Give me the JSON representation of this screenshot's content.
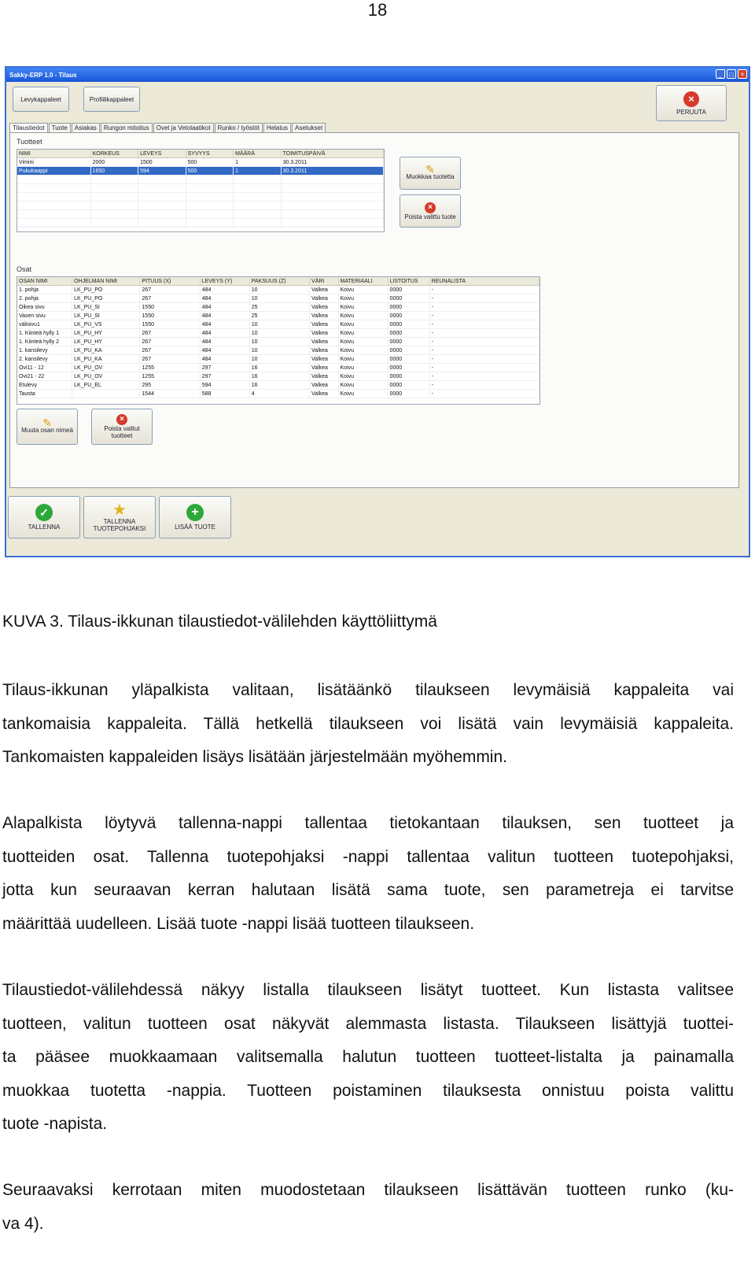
{
  "page_number": "18",
  "window": {
    "title": "Sakky-ERP 1.0 - Tilaus",
    "top_buttons": {
      "levy": "Levykappaleet",
      "profiili": "Profiilikappaleet",
      "peruuta": "PERUUTA"
    },
    "tabs": [
      "Tilaustiedot",
      "Tuote",
      "Asiakas",
      "Rungon mitoitus",
      "Ovet ja Vetolaatikot",
      "Runko / työstöt",
      "Helatus",
      "Asetukset"
    ],
    "tuotteet": {
      "label": "Tuotteet",
      "columns": [
        "NIMI",
        "KORKEUS",
        "LEVEYS",
        "SYVYYS",
        "MÄÄRÄ",
        "TOIMITUSPÄIVÄ"
      ],
      "rows": [
        [
          "Vimini",
          "2000",
          "1500",
          "500",
          "1",
          "30.3.2011"
        ],
        [
          "Pukukaappi",
          "1650",
          "594",
          "500",
          "1",
          "30.3.2011"
        ]
      ],
      "buttons": {
        "muokkaa": "Muokkaa tuotetta",
        "poista": "Poista valittu tuote"
      }
    },
    "osat": {
      "label": "Osat",
      "columns": [
        "OSAN NIMI",
        "OHJELMAN NIMI",
        "PITUUS (X)",
        "LEVEYS (Y)",
        "PAKSUUS (Z)",
        "VÄRI",
        "MATERIAALI",
        "LISTOITUS",
        "REUNALISTA"
      ],
      "rows": [
        [
          "1. pohja",
          "LK_PU_PO",
          "267",
          "484",
          "10",
          "Valkea",
          "Koivu",
          "0000",
          "-"
        ],
        [
          "2. pohja",
          "LK_PU_PO",
          "267",
          "484",
          "10",
          "Valkea",
          "Koivu",
          "0000",
          "-"
        ],
        [
          "Oikea sivu",
          "LK_PU_SI",
          "1550",
          "484",
          "25",
          "Valkea",
          "Koivu",
          "0000",
          "-"
        ],
        [
          "Vasen sivu",
          "LK_PU_SI",
          "1550",
          "484",
          "25",
          "Valkea",
          "Koivu",
          "0000",
          "-"
        ],
        [
          "välisivu1",
          "LK_PU_VS",
          "1550",
          "484",
          "10",
          "Valkea",
          "Koivu",
          "0000",
          "-"
        ],
        [
          "1. Kiinteä hylly 1",
          "LK_PU_HY",
          "267",
          "484",
          "10",
          "Valkea",
          "Koivu",
          "0000",
          "-"
        ],
        [
          "1. Kiinteä hylly 2",
          "LK_PU_HY",
          "267",
          "484",
          "10",
          "Valkea",
          "Koivu",
          "0000",
          "-"
        ],
        [
          "1. kansilevy",
          "LK_PU_KA",
          "267",
          "484",
          "10",
          "Valkea",
          "Koivu",
          "0000",
          "-"
        ],
        [
          "2. kansilevy",
          "LK_PU_KA",
          "267",
          "484",
          "10",
          "Valkea",
          "Koivu",
          "0000",
          "-"
        ],
        [
          "Ovi11 - 12",
          "LK_PU_OV",
          "1255",
          "297",
          "16",
          "Valkea",
          "Koivu",
          "0000",
          "-"
        ],
        [
          "Ovi21 - 22",
          "LK_PU_OV",
          "1255",
          "297",
          "16",
          "Valkea",
          "Koivu",
          "0000",
          "-"
        ],
        [
          "Etulevy",
          "LK_PU_EL",
          "295",
          "594",
          "16",
          "Valkea",
          "Koivu",
          "0000",
          "-"
        ],
        [
          "Tausta",
          "",
          "1544",
          "588",
          "4",
          "Valkea",
          "Koivu",
          "0000",
          "-"
        ]
      ],
      "buttons": {
        "muuta": "Muuta osan nimeä",
        "poista_line1": "Poista valitut",
        "poista_line2": "tuotteet"
      }
    },
    "bottom_buttons": {
      "tallenna": "TALLENNA",
      "pohja_line1": "TALLENNA",
      "pohja_line2": "TUOTEPOHJAKSI",
      "lisaa": "LISÄÄ TUOTE"
    }
  },
  "caption": "KUVA 3. Tilaus-ikkunan tilaustiedot-välilehden käyttöliittymä",
  "paragraphs": [
    [
      "Tilaus-ikkunan yläpalkista valitaan, lisätäänkö tilaukseen levymäisiä kappaleita vai",
      "tankomaisia kappaleita. Tällä hetkellä tilaukseen voi lisätä vain levymäisiä kappaleita.",
      "Tankomaisten kappaleiden lisäys lisätään järjestelmään myöhemmin."
    ],
    [
      "Alapalkista löytyvä tallenna-nappi tallentaa tietokantaan tilauksen, sen tuotteet ja",
      "tuotteiden osat. Tallenna tuotepohjaksi -nappi tallentaa valitun tuotteen tuotepohjaksi,",
      "jotta kun seuraavan kerran halutaan lisätä sama tuote, sen parametreja ei tarvitse",
      "määrittää uudelleen. Lisää tuote -nappi lisää tuotteen tilaukseen."
    ],
    [
      "Tilaustiedot-välilehdessä näkyy listalla tilaukseen lisätyt tuotteet. Kun listasta valitsee",
      "tuotteen, valitun tuotteen osat näkyvät alemmasta listasta. Tilaukseen lisättyjä tuottei-",
      "ta pääsee muokkaamaan valitsemalla halutun tuotteen tuotteet-listalta ja painamalla",
      "muokkaa tuotetta -nappia. Tuotteen poistaminen tilauksesta onnistuu poista valittu",
      "tuote -napista."
    ],
    [
      "Seuraavaksi kerrotaan miten muodostetaan tilaukseen lisättävän tuotteen runko (ku-",
      "va 4)."
    ]
  ]
}
